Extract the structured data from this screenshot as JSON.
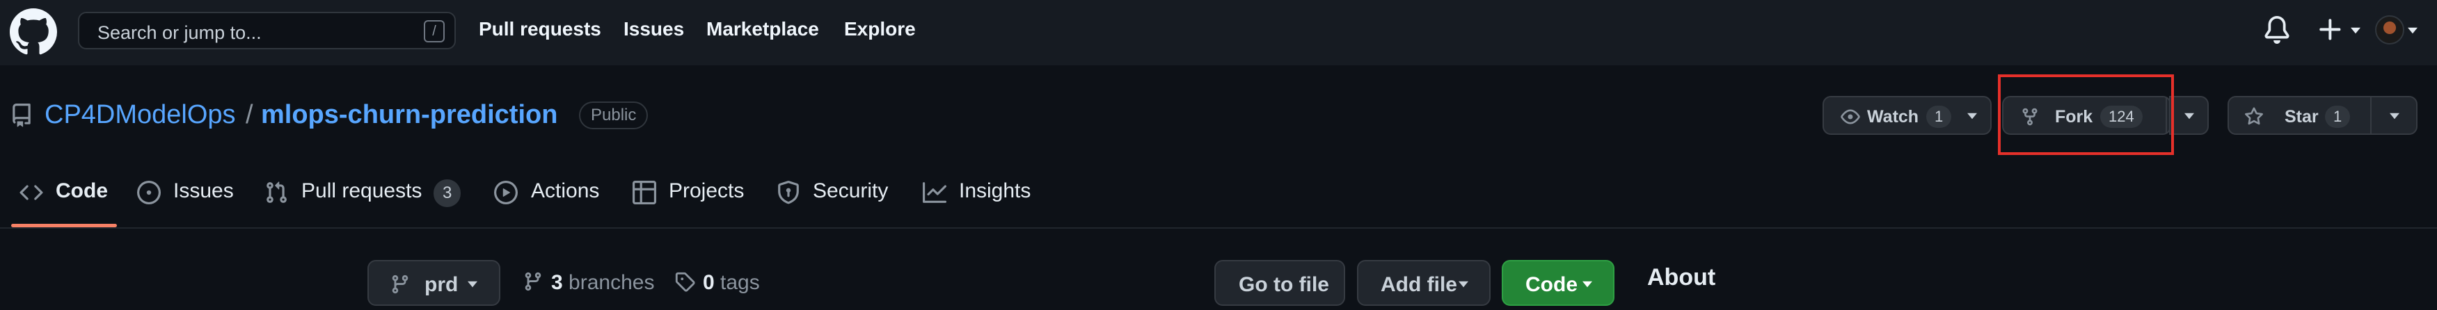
{
  "header": {
    "search_placeholder": "Search or jump to...",
    "search_shortcut": "/",
    "nav": [
      "Pull requests",
      "Issues",
      "Marketplace",
      "Explore"
    ]
  },
  "repo": {
    "owner": "CP4DModelOps",
    "separator": "/",
    "name": "mlops-churn-prediction",
    "visibility": "Public",
    "watch": {
      "label": "Watch",
      "count": "1"
    },
    "fork": {
      "label": "Fork",
      "count": "124"
    },
    "star": {
      "label": "Star",
      "count": "1"
    }
  },
  "tabs": [
    {
      "label": "Code",
      "icon": "code-icon"
    },
    {
      "label": "Issues",
      "icon": "issue-opened-icon"
    },
    {
      "label": "Pull requests",
      "icon": "git-pull-request-icon",
      "counter": "3"
    },
    {
      "label": "Actions",
      "icon": "play-icon"
    },
    {
      "label": "Projects",
      "icon": "table-icon"
    },
    {
      "label": "Security",
      "icon": "shield-icon"
    },
    {
      "label": "Insights",
      "icon": "graph-icon"
    }
  ],
  "code_toolbar": {
    "branch": "prd",
    "branches_count": "3",
    "branches_label": "branches",
    "tags_count": "0",
    "tags_label": "tags",
    "go_to_file": "Go to file",
    "add_file": "Add file",
    "code": "Code"
  },
  "sidebar": {
    "about_title": "About"
  },
  "colors": {
    "background": "#0d1117",
    "header": "#161b22",
    "link": "#58a6ff",
    "active_tab_underline": "#f78166",
    "code_button": "#238636",
    "highlight_box": "#e5302a"
  }
}
